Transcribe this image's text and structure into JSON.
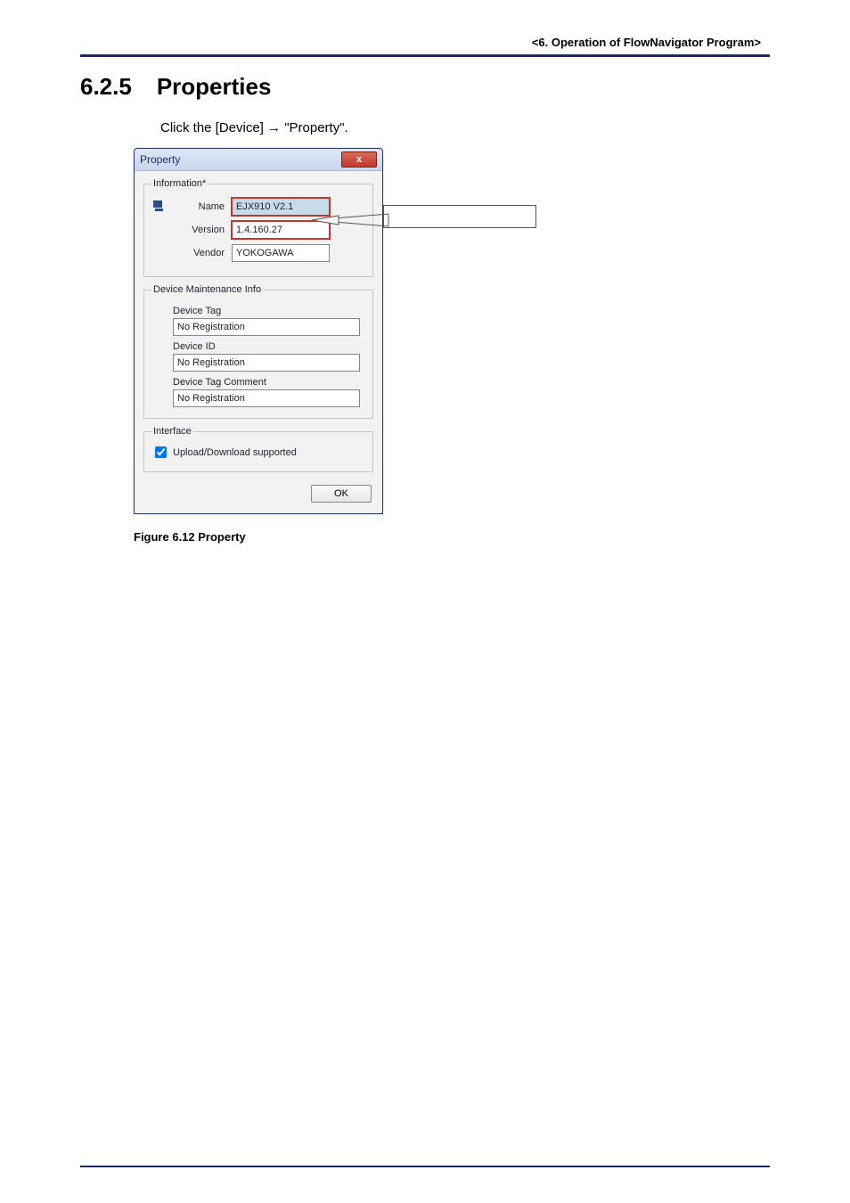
{
  "header": {
    "chapter_ref": "<6.  Operation of FlowNavigator Program>"
  },
  "heading": {
    "number": "6.2.5",
    "title": "Properties"
  },
  "instruction": "Click the [Device] → \"Property\".",
  "dialog": {
    "title": "Property",
    "close_glyph": "x",
    "information": {
      "legend": "Information*",
      "name_label": "Name",
      "name_value": "EJX910 V2.1",
      "version_label": "Version",
      "version_value": "1.4.160.27",
      "vendor_label": "Vendor",
      "vendor_value": "YOKOGAWA"
    },
    "maintenance": {
      "legend": "Device Maintenance Info",
      "device_tag_label": "Device Tag",
      "device_tag_value": "No Registration",
      "device_id_label": "Device ID",
      "device_id_value": "No Registration",
      "device_tag_comment_label": "Device Tag Comment",
      "device_tag_comment_value": "No Registration"
    },
    "interface": {
      "legend": "Interface",
      "upload_label": "Upload/Download supported"
    },
    "ok_label": "OK"
  },
  "figure_caption": "Figure 6.12     Property"
}
